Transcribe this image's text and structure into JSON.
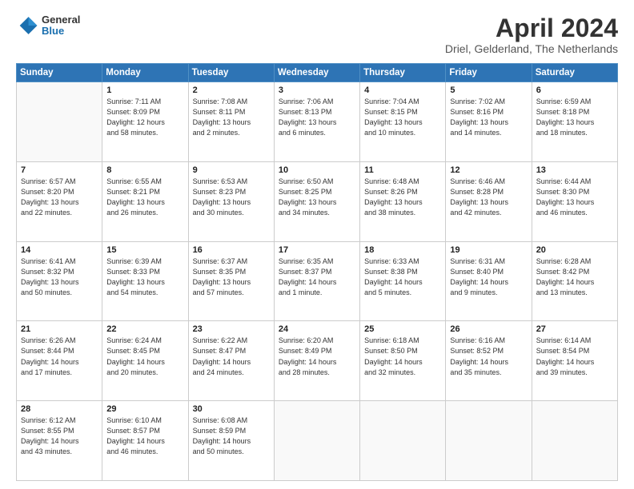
{
  "header": {
    "logo_general": "General",
    "logo_blue": "Blue",
    "month_title": "April 2024",
    "location": "Driel, Gelderland, The Netherlands"
  },
  "weekdays": [
    "Sunday",
    "Monday",
    "Tuesday",
    "Wednesday",
    "Thursday",
    "Friday",
    "Saturday"
  ],
  "weeks": [
    [
      {
        "day": "",
        "info": ""
      },
      {
        "day": "1",
        "info": "Sunrise: 7:11 AM\nSunset: 8:09 PM\nDaylight: 12 hours\nand 58 minutes."
      },
      {
        "day": "2",
        "info": "Sunrise: 7:08 AM\nSunset: 8:11 PM\nDaylight: 13 hours\nand 2 minutes."
      },
      {
        "day": "3",
        "info": "Sunrise: 7:06 AM\nSunset: 8:13 PM\nDaylight: 13 hours\nand 6 minutes."
      },
      {
        "day": "4",
        "info": "Sunrise: 7:04 AM\nSunset: 8:15 PM\nDaylight: 13 hours\nand 10 minutes."
      },
      {
        "day": "5",
        "info": "Sunrise: 7:02 AM\nSunset: 8:16 PM\nDaylight: 13 hours\nand 14 minutes."
      },
      {
        "day": "6",
        "info": "Sunrise: 6:59 AM\nSunset: 8:18 PM\nDaylight: 13 hours\nand 18 minutes."
      }
    ],
    [
      {
        "day": "7",
        "info": "Sunrise: 6:57 AM\nSunset: 8:20 PM\nDaylight: 13 hours\nand 22 minutes."
      },
      {
        "day": "8",
        "info": "Sunrise: 6:55 AM\nSunset: 8:21 PM\nDaylight: 13 hours\nand 26 minutes."
      },
      {
        "day": "9",
        "info": "Sunrise: 6:53 AM\nSunset: 8:23 PM\nDaylight: 13 hours\nand 30 minutes."
      },
      {
        "day": "10",
        "info": "Sunrise: 6:50 AM\nSunset: 8:25 PM\nDaylight: 13 hours\nand 34 minutes."
      },
      {
        "day": "11",
        "info": "Sunrise: 6:48 AM\nSunset: 8:26 PM\nDaylight: 13 hours\nand 38 minutes."
      },
      {
        "day": "12",
        "info": "Sunrise: 6:46 AM\nSunset: 8:28 PM\nDaylight: 13 hours\nand 42 minutes."
      },
      {
        "day": "13",
        "info": "Sunrise: 6:44 AM\nSunset: 8:30 PM\nDaylight: 13 hours\nand 46 minutes."
      }
    ],
    [
      {
        "day": "14",
        "info": "Sunrise: 6:41 AM\nSunset: 8:32 PM\nDaylight: 13 hours\nand 50 minutes."
      },
      {
        "day": "15",
        "info": "Sunrise: 6:39 AM\nSunset: 8:33 PM\nDaylight: 13 hours\nand 54 minutes."
      },
      {
        "day": "16",
        "info": "Sunrise: 6:37 AM\nSunset: 8:35 PM\nDaylight: 13 hours\nand 57 minutes."
      },
      {
        "day": "17",
        "info": "Sunrise: 6:35 AM\nSunset: 8:37 PM\nDaylight: 14 hours\nand 1 minute."
      },
      {
        "day": "18",
        "info": "Sunrise: 6:33 AM\nSunset: 8:38 PM\nDaylight: 14 hours\nand 5 minutes."
      },
      {
        "day": "19",
        "info": "Sunrise: 6:31 AM\nSunset: 8:40 PM\nDaylight: 14 hours\nand 9 minutes."
      },
      {
        "day": "20",
        "info": "Sunrise: 6:28 AM\nSunset: 8:42 PM\nDaylight: 14 hours\nand 13 minutes."
      }
    ],
    [
      {
        "day": "21",
        "info": "Sunrise: 6:26 AM\nSunset: 8:44 PM\nDaylight: 14 hours\nand 17 minutes."
      },
      {
        "day": "22",
        "info": "Sunrise: 6:24 AM\nSunset: 8:45 PM\nDaylight: 14 hours\nand 20 minutes."
      },
      {
        "day": "23",
        "info": "Sunrise: 6:22 AM\nSunset: 8:47 PM\nDaylight: 14 hours\nand 24 minutes."
      },
      {
        "day": "24",
        "info": "Sunrise: 6:20 AM\nSunset: 8:49 PM\nDaylight: 14 hours\nand 28 minutes."
      },
      {
        "day": "25",
        "info": "Sunrise: 6:18 AM\nSunset: 8:50 PM\nDaylight: 14 hours\nand 32 minutes."
      },
      {
        "day": "26",
        "info": "Sunrise: 6:16 AM\nSunset: 8:52 PM\nDaylight: 14 hours\nand 35 minutes."
      },
      {
        "day": "27",
        "info": "Sunrise: 6:14 AM\nSunset: 8:54 PM\nDaylight: 14 hours\nand 39 minutes."
      }
    ],
    [
      {
        "day": "28",
        "info": "Sunrise: 6:12 AM\nSunset: 8:55 PM\nDaylight: 14 hours\nand 43 minutes."
      },
      {
        "day": "29",
        "info": "Sunrise: 6:10 AM\nSunset: 8:57 PM\nDaylight: 14 hours\nand 46 minutes."
      },
      {
        "day": "30",
        "info": "Sunrise: 6:08 AM\nSunset: 8:59 PM\nDaylight: 14 hours\nand 50 minutes."
      },
      {
        "day": "",
        "info": ""
      },
      {
        "day": "",
        "info": ""
      },
      {
        "day": "",
        "info": ""
      },
      {
        "day": "",
        "info": ""
      }
    ]
  ]
}
